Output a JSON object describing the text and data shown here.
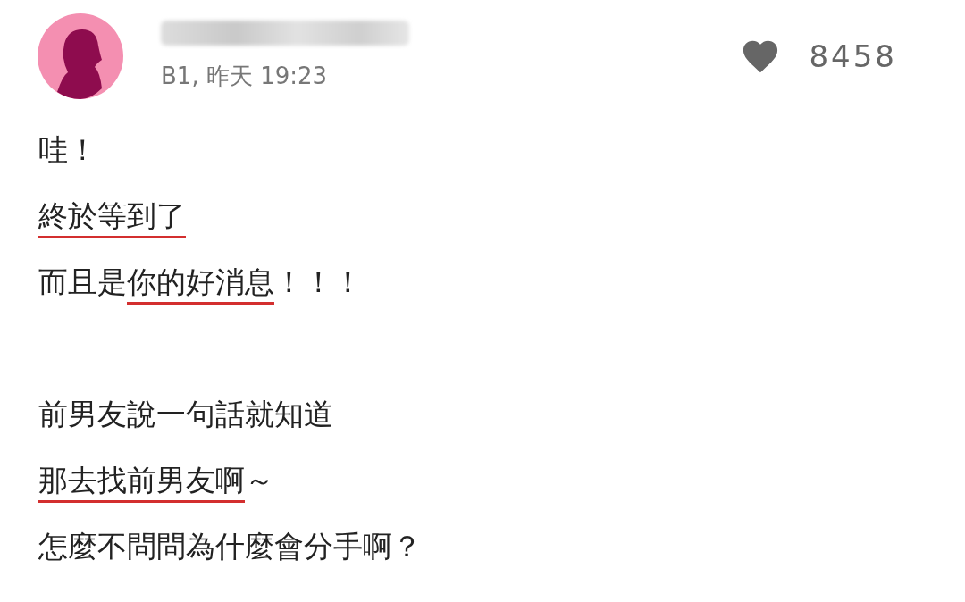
{
  "post": {
    "floor_time": "B1, 昨天 19:23",
    "likes": "8458",
    "liked": false
  },
  "lines": [
    {
      "blank_line_before": false,
      "segments": [
        {
          "text": "哇！",
          "underlined": false
        }
      ]
    },
    {
      "blank_line_before": false,
      "segments": [
        {
          "text": "終於等到了",
          "underlined": true
        }
      ]
    },
    {
      "blank_line_before": false,
      "segments": [
        {
          "text": "而且是",
          "underlined": false
        },
        {
          "text": "你的好消息",
          "underlined": true
        },
        {
          "text": "！！！",
          "underlined": false
        }
      ]
    },
    {
      "blank_line_before": true,
      "segments": [
        {
          "text": "前男友說一句話就知道",
          "underlined": false
        }
      ]
    },
    {
      "blank_line_before": false,
      "segments": [
        {
          "text": "那去找前男友啊",
          "underlined": true
        },
        {
          "text": "～",
          "underlined": false
        }
      ]
    },
    {
      "blank_line_before": false,
      "segments": [
        {
          "text": "怎麼不問問為什麼會分手啊？",
          "underlined": false
        }
      ]
    }
  ]
}
